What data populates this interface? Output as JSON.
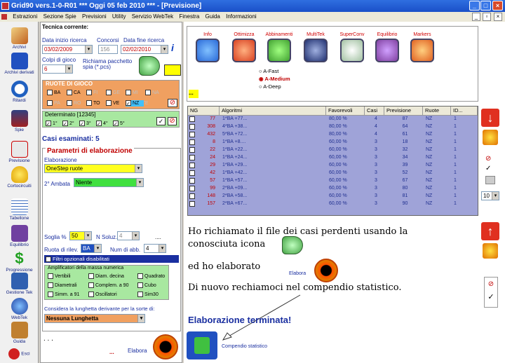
{
  "window": {
    "title": "Grid90 vers.1-0-R01  ***  Oggi 05 feb 2010  ***  - [Previsione]",
    "min": "_",
    "max": "□",
    "close": "×"
  },
  "menu": [
    "Estrazioni",
    "Sezione Spie",
    "Previsioni",
    "Utility",
    "Servizio WebTek",
    "Finestra",
    "Guida",
    "Informazioni"
  ],
  "leftbar": [
    "Archivi",
    "Archivi derivati",
    "Ritardi",
    "Spie",
    "Previsione",
    "Cortocircuiti",
    "Tabellone",
    "Equilibrio",
    "Progressione",
    "Gestione Tek",
    "WebTek",
    "Guida",
    "Esci"
  ],
  "tecnica": {
    "title": "Tecnica corrente:",
    "data_inizio_label": "Data inizio ricerca",
    "data_inizio": "03/02/2009",
    "concorsi_label": "Concorsi",
    "concorsi": "156",
    "data_fine_label": "Data fine ricerca",
    "data_fine": "02/02/2010",
    "colpi_label": "Colpi di gioco",
    "colpi": "6",
    "richiama_label": "Richiama pacchetto spia (*.pcs)",
    "ruote_title": "RUOTE DI GIOCO",
    "ruote_row1": [
      "BA",
      "CA",
      "FI",
      "GE",
      "MI",
      "NA"
    ],
    "ruote_row2": [
      "PA",
      "RO",
      "TO",
      "VE",
      "TUTTE",
      "NZ"
    ],
    "determinato_label": "Determinato [12345]",
    "determinato": [
      "1°",
      "2°",
      "3°",
      "4°",
      "5°"
    ],
    "casi_esaminati": "Casi esaminati: 5",
    "parametri_title": "Parametri di elaborazione",
    "elaborazione_label": "Elaborazione",
    "elaborazione": "OneStep ruote",
    "ambata_label": "2° Ambata",
    "ambata": "Niente",
    "soglia_label": "Soglia %",
    "soglia": "50",
    "nsoluz_label": "N Soluz.",
    "nsoluz": "4",
    "ruota_rilev_label": "Ruota di rilev.",
    "ruota_rilev": "BA",
    "num_abb_label": "Num di abb.",
    "num_abb": "4",
    "filtri_label": "Filtri opzionali disabilitati",
    "ampl_title": "Amplificatori della massa numerica",
    "ampl": [
      "Vertibili",
      "Diam. decina",
      "Quadrato",
      "Diametrali",
      "Complem. a 90",
      "Cubo",
      "Simm. a 91",
      "Oscillatori",
      "Sim30"
    ],
    "lunghetta_label": "Considera la lunghetta derivante per la sorte di:",
    "lunghetta": "Nessuna Lunghetta",
    "dots1": ". . .",
    "dots2": "...",
    "elabora": "Elabora"
  },
  "modules": [
    {
      "label": "Info",
      "color": "#2a6ad8"
    },
    {
      "label": "Ottimizza",
      "color": "#d84020"
    },
    {
      "label": "Abbinamenti",
      "color": "#40a030"
    },
    {
      "label": "MultiTek",
      "color": "#203070"
    },
    {
      "label": "SuperConv",
      "color": "#a0c0a0"
    },
    {
      "label": "Equilibrio",
      "color": "#8040a0"
    },
    {
      "label": "Markers",
      "color": "#e06020"
    }
  ],
  "modes": [
    "A-Fast",
    "A-Medium",
    "A-Deep"
  ],
  "grid": {
    "headers": [
      "NG",
      "Algoritmi",
      "Favorevoli",
      "Casi",
      "Previsione",
      "Ruote",
      "ID..."
    ],
    "rows": [
      [
        "77",
        "1*BA +77...",
        "80,00 %",
        "4",
        "87",
        "NZ",
        "1"
      ],
      [
        "308",
        "4*BA +38...",
        "80,00 %",
        "4",
        "64",
        "NZ",
        "1"
      ],
      [
        "432",
        "5*BA +72...",
        "80,00 %",
        "4",
        "61",
        "NZ",
        "1"
      ],
      [
        "8",
        "1*BA +8....",
        "60,00 %",
        "3",
        "18",
        "NZ",
        "1"
      ],
      [
        "22",
        "1*BA +22...",
        "60,00 %",
        "3",
        "32",
        "NZ",
        "1"
      ],
      [
        "24",
        "1*BA +24...",
        "60,00 %",
        "3",
        "34",
        "NZ",
        "1"
      ],
      [
        "29",
        "1*BA +29...",
        "60,00 %",
        "3",
        "39",
        "NZ",
        "1"
      ],
      [
        "42",
        "1*BA +42...",
        "60,00 %",
        "3",
        "52",
        "NZ",
        "1"
      ],
      [
        "57",
        "1*BA +57...",
        "60,00 %",
        "3",
        "67",
        "NZ",
        "1"
      ],
      [
        "99",
        "2*BA +09...",
        "60,00 %",
        "3",
        "80",
        "NZ",
        "1"
      ],
      [
        "148",
        "2*BA +58...",
        "60,00 %",
        "3",
        "81",
        "NZ",
        "1"
      ],
      [
        "157",
        "2*BA +67...",
        "60,00 %",
        "3",
        "90",
        "NZ",
        "1"
      ]
    ]
  },
  "notes": {
    "line1": "Ho richiamato il file dei casi perdenti usando la",
    "line2": "conosciuta icona",
    "line3": "ed ho elaborato",
    "elabora_label": "Elabora",
    "line4": "Di nuovo rechiamoci nel compendio statistico.",
    "terminata": "Elaborazione terminata!",
    "compendio": "Compendio statistico"
  },
  "side": {
    "spin": "10"
  }
}
